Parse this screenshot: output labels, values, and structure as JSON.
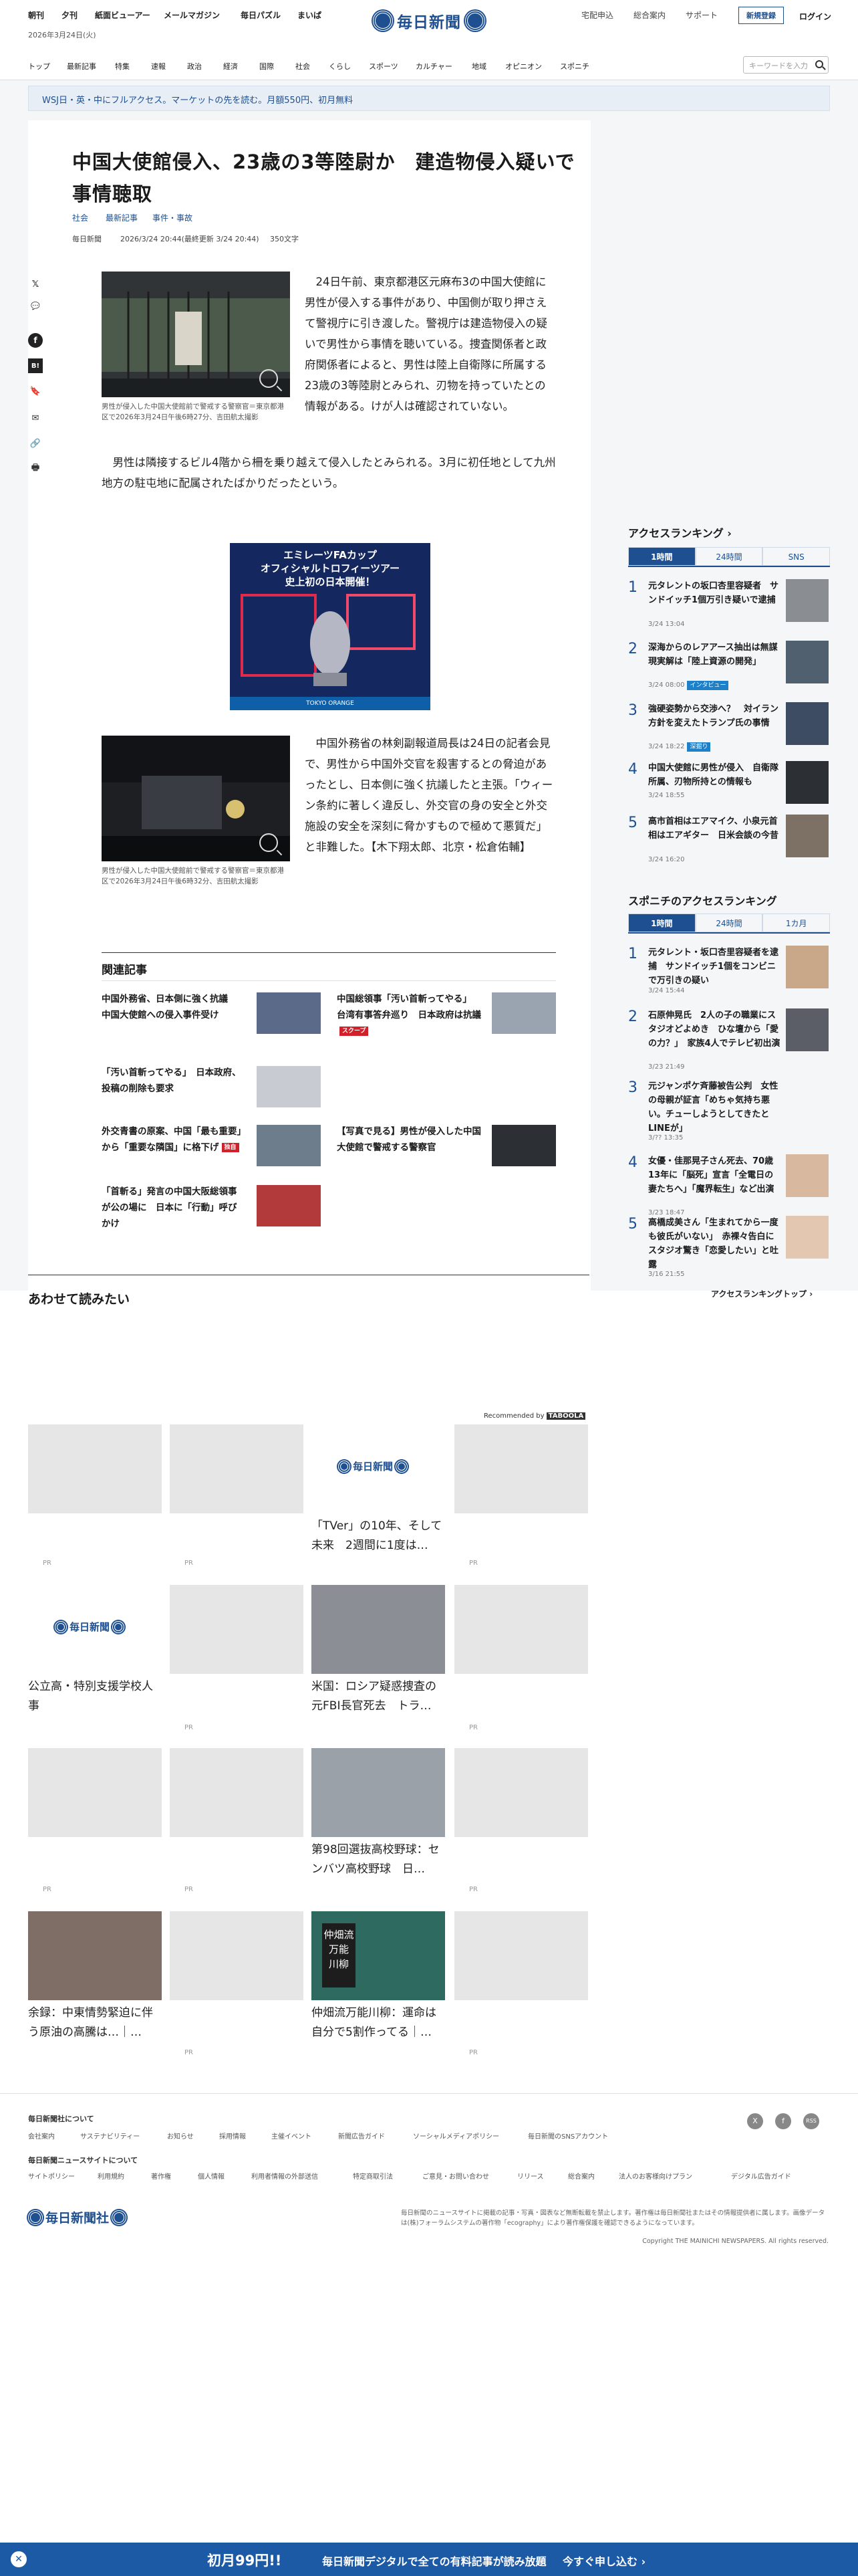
{
  "header": {
    "services": [
      "朝刊",
      "夕刊",
      "紙面ビューアー",
      "メールマガジン",
      "毎日パズル",
      "まいぱ"
    ],
    "logo": "毎日新聞",
    "util": [
      "宅配申込",
      "総合案内",
      "サポート"
    ],
    "register": "新規登録",
    "login": "ログイン",
    "date": "2026年3月24日(火)",
    "nav": [
      "トップ",
      "最新記事",
      "特集",
      "速報",
      "政治",
      "経済",
      "国際",
      "社会",
      "くらし",
      "スポーツ",
      "カルチャー",
      "地域",
      "オピニオン",
      "スポニチ"
    ],
    "search_placeholder": "キーワードを入力"
  },
  "banner": "WSJ日・英・中にフルアクセス。マーケットの先を読む。月額550円、初月無料",
  "article": {
    "title": "中国大使館侵入、23歳の3等陸尉か　建造物侵入疑いで事情聴取",
    "tags": [
      "社会",
      "最新記事",
      "事件・事故"
    ],
    "source": "毎日新聞",
    "datetime": "2026/3/24 20:44(最終更新 3/24 20:44)",
    "chars": "350文字",
    "photo1_cap": "男性が侵入した中国大使館前で警戒する警察官＝東京都港区で2026年3月24日午後6時27分、吉田航太撮影",
    "p1": "　24日午前、東京都港区元麻布3の中国大使館に男性が侵入する事件があり、中国側が取り押さえて警視庁に引き渡した。警視庁は建造物侵入の疑いで男性から事情を聴いている。捜査関係者と政府関係者によると、男性は陸上自衛隊に所属する23歳の3等陸尉とみられ、刃物を持っていたとの情報がある。けが人は確認されていない。",
    "p2": "　男性は隣接するビル4階から柵を乗り越えて侵入したとみられる。3月に初任地として九州地方の駐屯地に配属されたばかりだったという。",
    "ad_text": "エミレーツFAカップ\nオフィシャルトロフィーツアー\n史上初の日本開催！",
    "ad_sub": "TOKYO ORANGE",
    "photo2_cap": "男性が侵入した中国大使館前で警戒する警察官＝東京都港区で2026年3月24日午後6時32分、吉田航太撮影",
    "p3": "　中国外務省の林剣副報道局長は24日の記者会見で、男性から中国外交官を殺害するとの脅迫があったとし、日本側に強く抗議したと主張。「ウィーン条約に著しく違反し、外交官の身の安全と外交施設の安全を深刻に脅かすもので極めて悪質だ」と非難した。【木下翔太郎、北京・松倉佑輔】"
  },
  "related": {
    "heading": "関連記事",
    "items": [
      {
        "title": "中国外務省、日本側に強く抗議　中国大使館への侵入事件受け",
        "badge": ""
      },
      {
        "title": "中国総領事「汚い首斬ってやる」　台湾有事答弁巡り　日本政府は抗議",
        "badge": "スクープ"
      },
      {
        "title": "「汚い首斬ってやる」　日本政府、投稿の削除も要求",
        "badge": ""
      },
      {
        "title": "外交青書の原案、中国「最も重要」から「重要な隣国」に格下げ",
        "badge": "独自"
      },
      {
        "title": "【写真で見る】男性が侵入した中国大使館で警戒する警察官",
        "badge": ""
      },
      {
        "title": "「首斬る」発言の中国大阪総領事が公の場に　日本に「行動」呼びかけ",
        "badge": ""
      }
    ]
  },
  "ranking": {
    "heading": "アクセスランキング",
    "tabs": [
      "1時間",
      "24時間",
      "SNS"
    ],
    "items": [
      {
        "rank": "1",
        "title": "元タレントの坂口杏里容疑者　サンドイッチ1個万引き疑いで逮捕",
        "date": "3/24 13:04",
        "badge": ""
      },
      {
        "rank": "2",
        "title": "深海からのレアアース抽出は無謀　現実解は「陸上資源の開発」",
        "date": "3/24 08:00",
        "badge": "インタビュー"
      },
      {
        "rank": "3",
        "title": "強硬姿勢から交渉へ？　対イラン方針を変えたトランプ氏の事情",
        "date": "3/24 18:22",
        "badge": "深掘り"
      },
      {
        "rank": "4",
        "title": "中国大使館に男性が侵入　自衛隊所属、刃物所持との情報も",
        "date": "3/24 18:55",
        "badge": ""
      },
      {
        "rank": "5",
        "title": "高市首相はエアマイク、小泉元首相はエアギター　日米会談の今昔",
        "date": "3/24 16:20",
        "badge": ""
      }
    ]
  },
  "sponichi": {
    "heading": "スポニチのアクセスランキング",
    "tabs": [
      "1時間",
      "24時間",
      "1カ月"
    ],
    "items": [
      {
        "rank": "1",
        "title": "元タレント・坂口杏里容疑者を逮捕　サンドイッチ1個をコンビニで万引きの疑い",
        "date": "3/24 15:44"
      },
      {
        "rank": "2",
        "title": "石原伸晃氏　2人の子の職業にスタジオどよめき　ひな壇から「愛の力？」　家族4人でテレビ初出演",
        "date": "3/23 21:49"
      },
      {
        "rank": "3",
        "title": "元ジャンポケ斉藤被告公判　女性の母親が証言「めちゃ気持ち悪い。チューしようとしてきたとLINEが」",
        "date": "3/?? 13:35"
      },
      {
        "rank": "4",
        "title": "女優・佳那晃子さん死去、70歳　13年に「脳死」宣言「全電日の妻たちへ」「魔界転生」など出演",
        "date": "3/23 18:47"
      },
      {
        "rank": "5",
        "title": "高橋成美さん「生まれてから一度も彼氏がいない」　赤裸々告白にスタジオ驚き「恋愛したい」と吐露",
        "date": "3/16 21:55"
      }
    ],
    "more": "アクセスランキングトップ"
  },
  "recommend": {
    "heading": "あわせて読みたい",
    "by": "Recommended by",
    "brand": "TABOOLA",
    "cards": [
      {
        "title": "「TVer」の10年、そして未来　2週間に1度は…"
      },
      {
        "title": "公立高・特別支援学校人事"
      },
      {
        "title": "米国：ロシア疑惑捜査の元FBI長官死去　トラ…"
      },
      {
        "title": "第98回選抜高校野球：センバツ高校野球　日…"
      },
      {
        "title": "余録：中東情勢緊迫に伴う原油の高騰は…｜…"
      },
      {
        "title": "仲畑流万能川柳：運命は自分で5割作ってる｜…"
      }
    ],
    "pr": "PR"
  },
  "footer": {
    "h1": "毎日新聞社について",
    "links1": [
      "会社案内",
      "サステナビリティー",
      "お知らせ",
      "採用情報",
      "主催イベント",
      "新聞広告ガイド",
      "ソーシャルメディアポリシー",
      "毎日新聞のSNSアカウント"
    ],
    "h2": "毎日新聞ニュースサイトについて",
    "links2": [
      "サイトポリシー",
      "利用規約",
      "著作権",
      "個人情報",
      "利用者情報の外部送信",
      "特定商取引法",
      "ご意見・お問い合わせ",
      "リリース",
      "総合案内",
      "法人のお客様向けプラン",
      "デジタル広告ガイド"
    ],
    "company": "毎日新聞社",
    "note": "毎日新聞のニュースサイトに掲載の記事・写真・図表など無断転載を禁止します。著作権は毎日新聞社またはその情報提供者に属します。画像データは(株)フォーラムシステムの著作物「ecography」により著作権保護を確認できるようになっています。",
    "copy": "Copyright THE MAINICHI NEWSPAPERS. All rights reserved.",
    "social": [
      "X",
      "f",
      "RSS"
    ]
  },
  "bottom": {
    "price": "初月99円!!",
    "desc": "毎日新聞デジタルで全ての有料記事が読み放題",
    "cta": "今すぐ申し込む"
  }
}
